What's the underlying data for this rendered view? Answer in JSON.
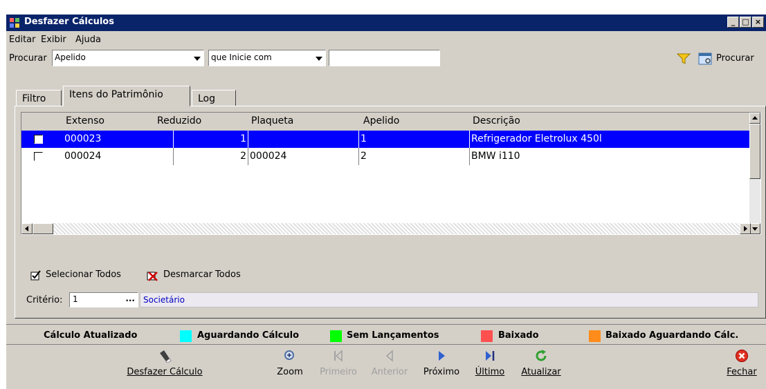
{
  "window": {
    "title": "Desfazer Cálculos",
    "min_label": "_",
    "max_label": "□",
    "close_label": "×"
  },
  "menu": [
    "Editar",
    "Exibir",
    "Ajuda"
  ],
  "search": {
    "label": "Procurar",
    "field": "Apelido",
    "operator": "que Inicie com",
    "value": "",
    "button_label": "Procurar"
  },
  "tabs": [
    "Filtro",
    "Itens do Patrimônio",
    "Log"
  ],
  "grid": {
    "columns": [
      "Extenso",
      "Reduzido",
      "Plaqueta",
      "Apelido",
      "Descrição"
    ],
    "rows": [
      {
        "extenso": "000023",
        "reduzido": "1",
        "plaqueta": "",
        "apelido": "1",
        "descricao": "Refrigerador Eletrolux 450l",
        "selected": true
      },
      {
        "extenso": "000024",
        "reduzido": "2",
        "plaqueta": "000024",
        "apelido": "2",
        "descricao": "BMW i110",
        "selected": false
      }
    ]
  },
  "selection": {
    "select_all": "Selecionar Todos",
    "deselect_all": "Desmarcar Todos"
  },
  "criterio": {
    "label": "Critério:",
    "value": "1",
    "dots": "...",
    "description": "Societário"
  },
  "legend": [
    {
      "label": "Cálculo Atualizado",
      "color": ""
    },
    {
      "label": "Aguardando Cálculo",
      "color": "#00ffff"
    },
    {
      "label": "Sem Lançamentos",
      "color": "#00ff00"
    },
    {
      "label": "Baixado",
      "color": "#ff5050"
    },
    {
      "label": "Baixado Aguardando Cálc.",
      "color": "#ff8c1a"
    }
  ],
  "toolbar": {
    "undo": "Desfazer Cálculo",
    "zoom": "Zoom",
    "first": "Primeiro",
    "prev": "Anterior",
    "next": "Próximo",
    "last": "Último",
    "refresh": "Atualizar",
    "close": "Fechar"
  }
}
